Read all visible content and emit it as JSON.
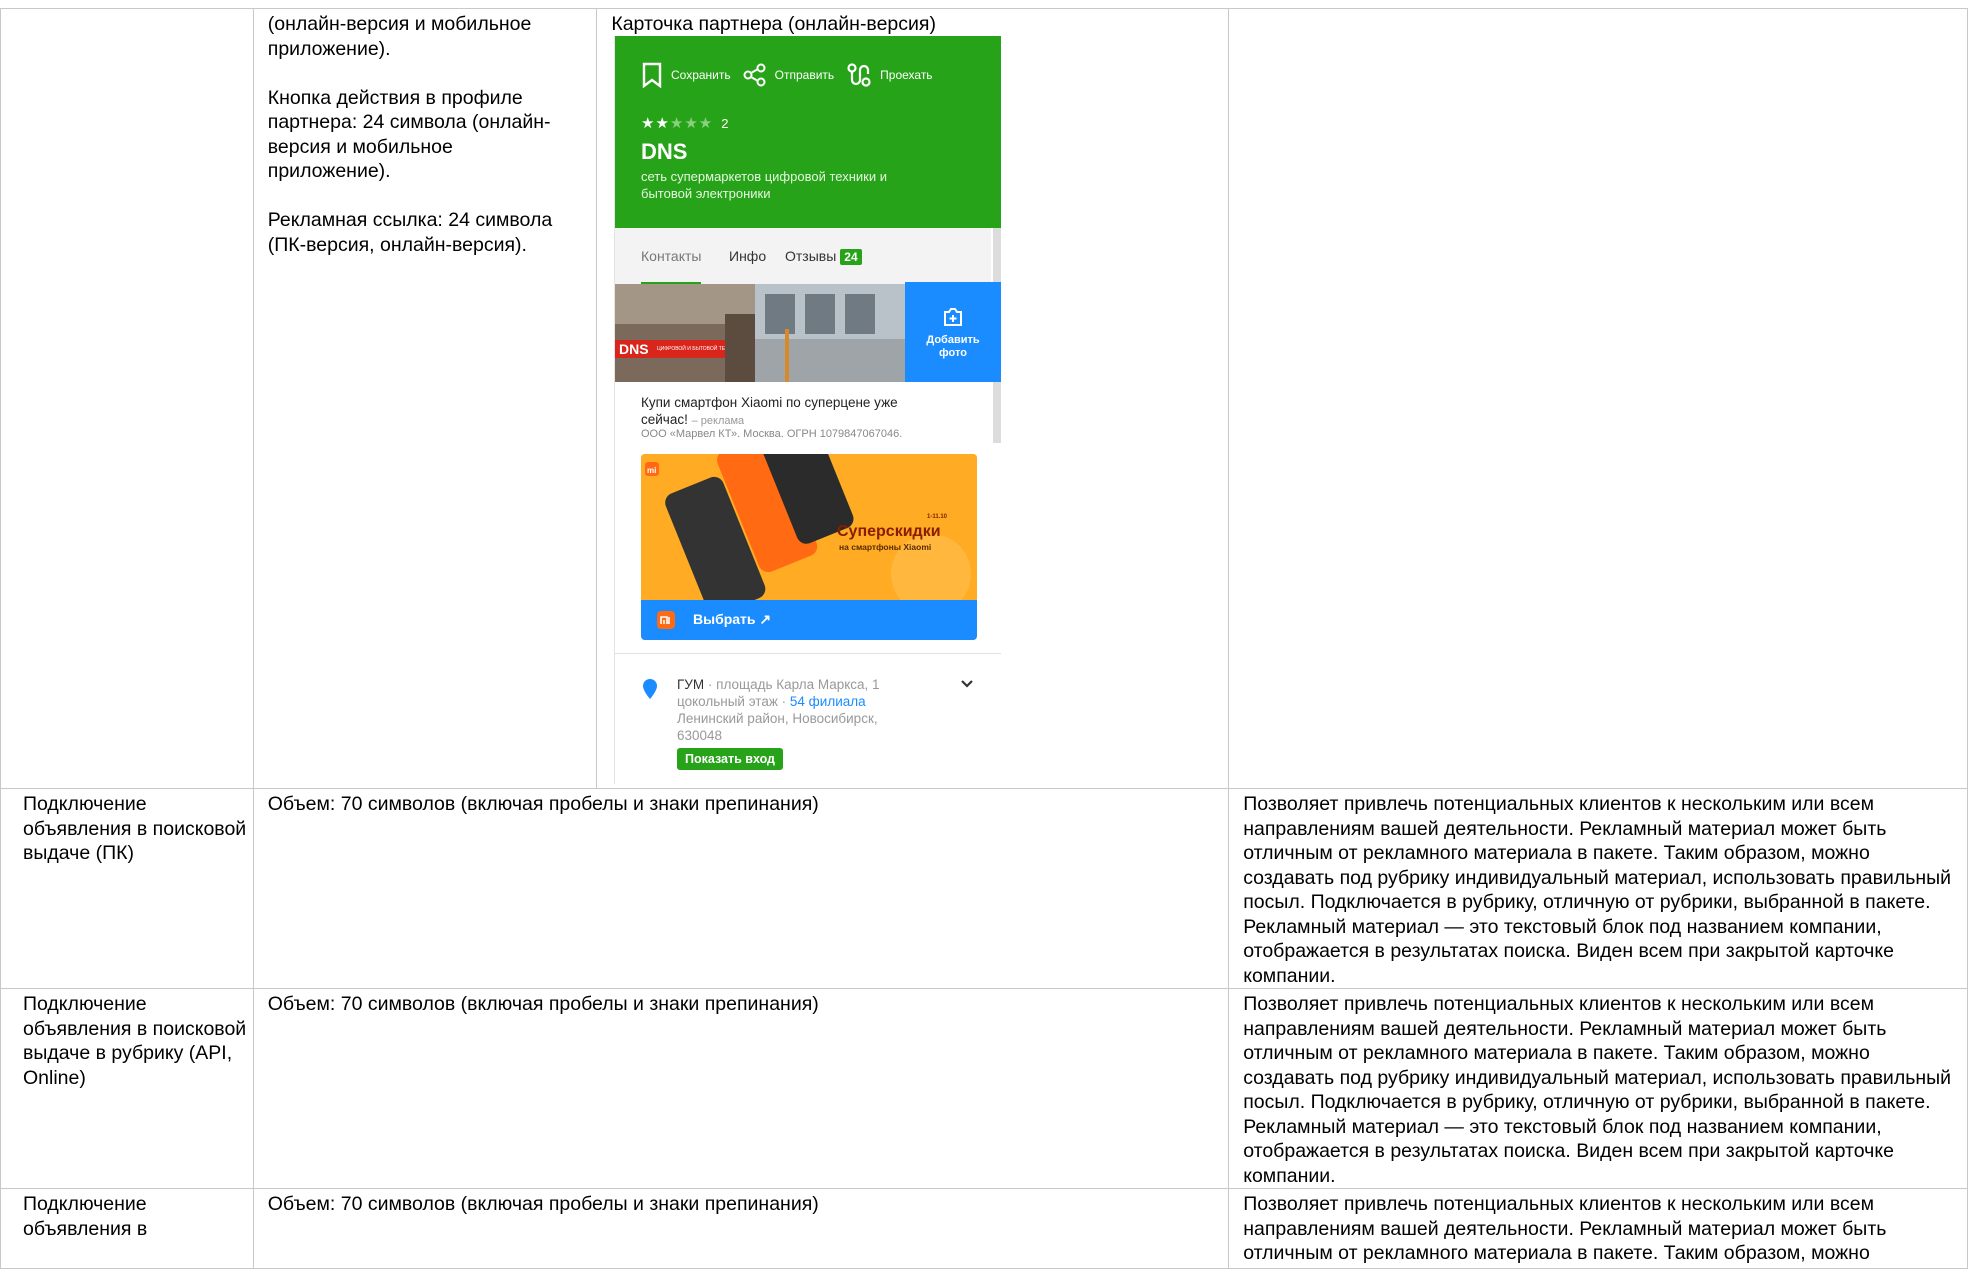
{
  "top_row": {
    "c2_lines": [
      "(онлайн-версия и мобильное",
      "приложение).",
      "",
      "Кнопка действия в профиле",
      "партнера: 24 символа (онлайн-",
      "версия и мобильное",
      "приложение).",
      "",
      "Рекламная ссылка: 24 символа",
      "(ПК-версия, онлайн-версия)."
    ],
    "c3_caption": "Карточка партнера (онлайн-версия)"
  },
  "phone": {
    "actions": [
      "Сохранить",
      "Отправить",
      "Проехать"
    ],
    "rating": {
      "filled": "★★",
      "empty": "★★★",
      "count": "2"
    },
    "title": "DNS",
    "subtitle": "сеть супермаркетов цифровой техники и бытовой электроники",
    "tabs": {
      "contacts": "Контакты",
      "info": "Инфо",
      "reviews": "Отзывы",
      "reviews_count": "24"
    },
    "add_photo_line1": "Добавить",
    "add_photo_line2": "фото",
    "store_sign": "DNS",
    "store_sign_small": "ЦИФРОВОЙ И БЫТОВОЙ ТЕХНИКИ",
    "ad_title": "Купи смартфон Xiaomi по суперцене уже сейчас!",
    "ad_label": "– реклама",
    "ad_org": "ООО «Марвел КТ». Москва. ОГРН 1079847067046.",
    "banner_sale": "Суперскидки",
    "banner_sale_sub": "на смартфоны Xiaomi",
    "banner_badge": "1-11.10",
    "banner_logo": "mi",
    "choose": "Выбрать ↗",
    "address_main": "ГУМ",
    "address_rest": "· площадь Карла Маркса, 1 цокольный этаж ·",
    "address_link": "54 филиала",
    "address_district": "Ленинский район, Новосибирск, 630048",
    "show_entrance": "Показать вход"
  },
  "rows": [
    {
      "name": "Подключение объявления в поисковой выдаче (ПК)",
      "volume": "Объем: 70 символов (включая пробелы и знаки препинания)",
      "description": "Позволяет привлечь потенциальных клиентов к нескольким или всем направлениям вашей деятельности. Рекламный материал может быть отличным от рекламного материала в пакете. Таким образом, можно создавать под рубрику индивидуальный материал, использовать правильный посыл. Подключается в рубрику, отличную от рубрики, выбранной в пакете. Рекламный материал — это текстовый блок под названием компании, отображается в результатах поиска. Виден всем при закрытой карточке компании."
    },
    {
      "name": "Подключение объявления в поисковой выдаче в рубрику (API, Online)",
      "volume": "Объем: 70 символов (включая пробелы и знаки препинания)",
      "description": "Позволяет привлечь потенциальных клиентов к нескольким или всем направлениям вашей деятельности. Рекламный материал может быть отличным от рекламного материала в пакете. Таким образом, можно создавать под рубрику индивидуальный материал, использовать правильный посыл. Подключается в рубрику, отличную от рубрики, выбранной в пакете. Рекламный материал — это текстовый блок под названием компании, отображается в результатах поиска. Виден всем при закрытой карточке компании."
    },
    {
      "name": "Подключение объявления в",
      "volume": "Объем: 70 символов (включая пробелы и знаки препинания)",
      "description": "Позволяет привлечь потенциальных клиентов к нескольким или всем направлениям вашей деятельности. Рекламный материал может быть отличным от рекламного материала в пакете. Таким образом, можно"
    }
  ]
}
